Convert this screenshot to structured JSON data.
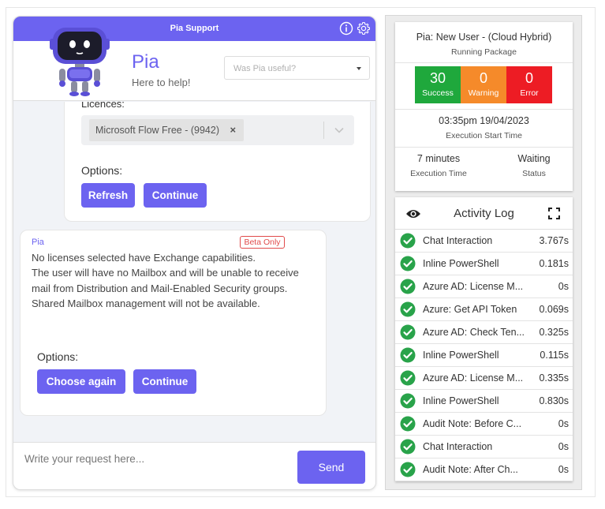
{
  "chat": {
    "topbar_title": "Pia Support",
    "bot_name": "Pia",
    "bot_tagline": "Here to help!",
    "useful_placeholder": "Was Pia useful?",
    "card1": {
      "licences_label": "Licences:",
      "selected_licence": "Microsoft Flow Free - (9942)",
      "remove_glyph": "×",
      "options_label": "Options:",
      "buttons": [
        "Refresh",
        "Continue"
      ]
    },
    "card2": {
      "sender": "Pia",
      "badge": "Beta Only",
      "message": [
        "No licenses selected have Exchange capabilities.",
        "The user will have no Mailbox and will be unable to receive mail from Distribution and Mail-Enabled Security groups.",
        "Shared Mailbox management will not be available."
      ],
      "options_label": "Options:",
      "buttons": [
        "Choose again",
        "Continue"
      ]
    },
    "input_placeholder": "Write your request here...",
    "send_label": "Send"
  },
  "package": {
    "title": "Pia: New User - (Cloud Hybrid)",
    "subtitle": "Running Package",
    "stats": [
      {
        "count": "30",
        "label": "Success",
        "color": "#1fa83c"
      },
      {
        "count": "0",
        "label": "Warning",
        "color": "#f58a2a"
      },
      {
        "count": "0",
        "label": "Error",
        "color": "#ed1c24"
      }
    ],
    "start_time": "03:35pm 19/04/2023",
    "start_time_label": "Execution Start Time",
    "duration": "7 minutes",
    "duration_label": "Execution Time",
    "status": "Waiting",
    "status_label": "Status"
  },
  "activity_log": {
    "title": "Activity Log",
    "rows": [
      {
        "name": "Chat Interaction",
        "duration": "3.767s"
      },
      {
        "name": "Inline PowerShell",
        "duration": "0.181s"
      },
      {
        "name": "Azure AD: License M...",
        "duration": "0s"
      },
      {
        "name": "Azure: Get API Token",
        "duration": "0.069s"
      },
      {
        "name": "Azure AD: Check Ten...",
        "duration": "0.325s"
      },
      {
        "name": "Inline PowerShell",
        "duration": "0.115s"
      },
      {
        "name": "Azure AD: License M...",
        "duration": "0.335s"
      },
      {
        "name": "Inline PowerShell",
        "duration": "0.830s"
      },
      {
        "name": "Audit Note: Before C...",
        "duration": "0s"
      },
      {
        "name": "Chat Interaction",
        "duration": "0s"
      },
      {
        "name": "Audit Note: After Ch...",
        "duration": "0s"
      }
    ]
  },
  "colors": {
    "accent": "#6c63f0",
    "success_check": "#29a34a",
    "beta_badge": "#e04a4a"
  }
}
